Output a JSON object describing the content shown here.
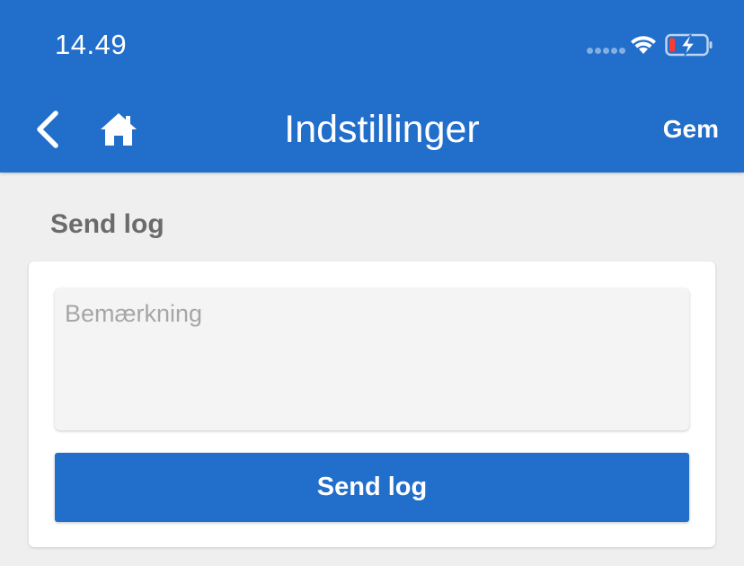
{
  "status_bar": {
    "time": "14.49",
    "signal_icon": "signal-dots-icon",
    "wifi_icon": "wifi-icon",
    "battery_icon": "battery-charging-low-icon",
    "battery_color": "#ff3b30"
  },
  "nav_bar": {
    "title": "Indstillinger",
    "back_icon": "chevron-left-icon",
    "home_icon": "home-icon",
    "save_label": "Gem",
    "background_color": "#216ecb"
  },
  "section": {
    "title": "Send log"
  },
  "remark": {
    "placeholder": "Bemærkning",
    "value": ""
  },
  "send_button": {
    "label": "Send log",
    "color": "#216ecb"
  }
}
